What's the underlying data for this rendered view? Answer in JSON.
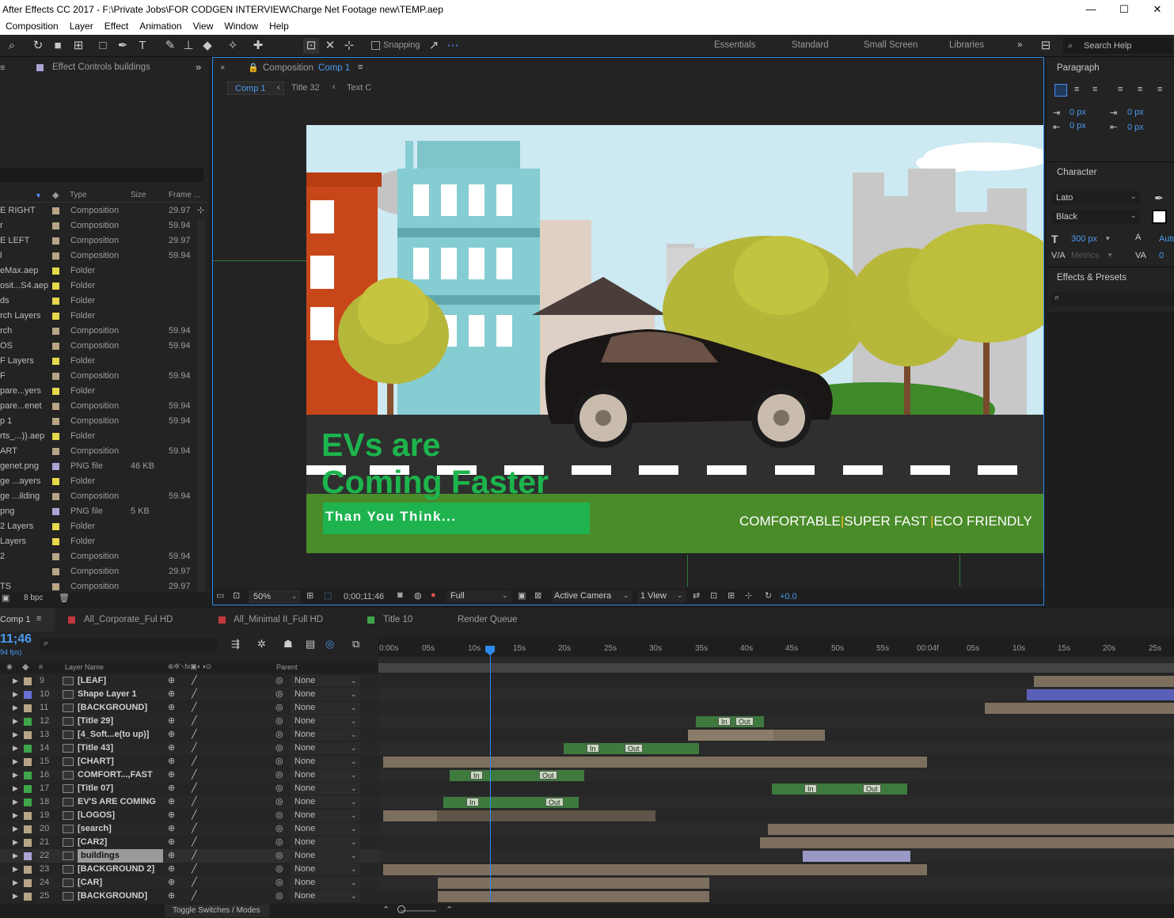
{
  "title": "After Effects CC 2017 - F:\\Private Jobs\\FOR CODGEN INTERVIEW\\Charge Net Footage new\\TEMP.aep",
  "window_controls": [
    "—",
    "☐",
    "✕"
  ],
  "menu": [
    "Composition",
    "Layer",
    "Effect",
    "Animation",
    "View",
    "Window",
    "Help"
  ],
  "toolbar": {
    "snapping": "Snapping",
    "workspaces": [
      "Essentials",
      "Standard",
      "Small Screen",
      "Libraries"
    ],
    "search_placeholder": "Search Help"
  },
  "project": {
    "tab": "Effect Controls buildings",
    "columns": {
      "type": "Type",
      "size": "Size",
      "frame": "Frame ..."
    },
    "rows": [
      {
        "name": "E RIGHT",
        "type": "Composition",
        "size": "",
        "frame": "29.97",
        "color": "#b7a586"
      },
      {
        "name": "r",
        "type": "Composition",
        "size": "",
        "frame": "59.94",
        "color": "#b7a586"
      },
      {
        "name": "E LEFT",
        "type": "Composition",
        "size": "",
        "frame": "29.97",
        "color": "#b7a586"
      },
      {
        "name": "l",
        "type": "Composition",
        "size": "",
        "frame": "59.94",
        "color": "#b7a586"
      },
      {
        "name": "eMax.aep",
        "type": "Folder",
        "size": "",
        "frame": "",
        "color": "#e6d84a"
      },
      {
        "name": "osit...S4.aep",
        "type": "Folder",
        "size": "",
        "frame": "",
        "color": "#e6d84a"
      },
      {
        "name": "ds",
        "type": "Folder",
        "size": "",
        "frame": "",
        "color": "#e6d84a"
      },
      {
        "name": "rch Layers",
        "type": "Folder",
        "size": "",
        "frame": "",
        "color": "#e6d84a"
      },
      {
        "name": "rch",
        "type": "Composition",
        "size": "",
        "frame": "59.94",
        "color": "#b7a586"
      },
      {
        "name": "OS",
        "type": "Composition",
        "size": "",
        "frame": "59.94",
        "color": "#b7a586"
      },
      {
        "name": "F Layers",
        "type": "Folder",
        "size": "",
        "frame": "",
        "color": "#e6d84a"
      },
      {
        "name": "F",
        "type": "Composition",
        "size": "",
        "frame": "59.94",
        "color": "#b7a586"
      },
      {
        "name": "pare...yers",
        "type": "Folder",
        "size": "",
        "frame": "",
        "color": "#e6d84a"
      },
      {
        "name": "pare...enet",
        "type": "Composition",
        "size": "",
        "frame": "59.94",
        "color": "#b7a586"
      },
      {
        "name": "p 1",
        "type": "Composition",
        "size": "",
        "frame": "59.94",
        "color": "#b7a586"
      },
      {
        "name": "rts_...)).aep",
        "type": "Folder",
        "size": "",
        "frame": "",
        "color": "#e6d84a"
      },
      {
        "name": "ART",
        "type": "Composition",
        "size": "",
        "frame": "59.94",
        "color": "#b7a586"
      },
      {
        "name": "genet.png",
        "type": "PNG file",
        "size": "46 KB",
        "frame": "",
        "color": "#a9a5d4"
      },
      {
        "name": "ge ...ayers",
        "type": "Folder",
        "size": "",
        "frame": "",
        "color": "#e6d84a"
      },
      {
        "name": "ge ...ilding",
        "type": "Composition",
        "size": "",
        "frame": "59.94",
        "color": "#b7a586"
      },
      {
        "name": "png",
        "type": "PNG file",
        "size": "5 KB",
        "frame": "",
        "color": "#a9a5d4"
      },
      {
        "name": "2 Layers",
        "type": "Folder",
        "size": "",
        "frame": "",
        "color": "#e6d84a"
      },
      {
        "name": " Layers",
        "type": "Folder",
        "size": "",
        "frame": "",
        "color": "#e6d84a"
      },
      {
        "name": "2",
        "type": "Composition",
        "size": "",
        "frame": "59.94",
        "color": "#b7a586"
      },
      {
        "name": "",
        "type": "Composition",
        "size": "",
        "frame": "29.97",
        "color": "#b7a586"
      },
      {
        "name": "TS",
        "type": "Composition",
        "size": "",
        "frame": "29.97",
        "color": "#b7a586"
      }
    ],
    "bpc": "8 bpc"
  },
  "composition": {
    "tab_label": "Composition",
    "tab_name": "Comp 1",
    "breadcrumbs": [
      "Comp 1",
      "Title 32",
      "Text C"
    ],
    "zoom": "50%",
    "timecode": "0;00;11;46",
    "resolution": "Full",
    "camera": "Active Camera",
    "views": "1 View",
    "exposure": "+0.0",
    "frame": {
      "headline1": "EVs are",
      "headline2": "Coming Faster",
      "subline": "Than You Think...",
      "tag1": "COMFORTABLE",
      "tag2": "SUPER FAST",
      "tag3": "ECO FRIENDLY",
      "sep": "|"
    }
  },
  "paragraph": {
    "title": "Paragraph",
    "indent": [
      "0 px",
      "0 px",
      "0 px",
      "0 px"
    ]
  },
  "character": {
    "title": "Character",
    "font": "Lato",
    "style": "Black",
    "size": "300 px",
    "leading": "Auto",
    "kerning": "Metrics",
    "tracking": "0"
  },
  "effects": {
    "title": "Effects & Presets"
  },
  "timeline": {
    "tabs": [
      "Comp 1",
      "All_Corporate_Ful HD",
      "All_Minimal II_Full HD",
      "Title 10",
      "Render Queue"
    ],
    "tab_colors": [
      "#b7a586",
      "#c4383d",
      "#c4383d",
      "#3fa64a"
    ],
    "timecode": "11;46",
    "fps": "94 fps)",
    "headers": {
      "num": "#",
      "name": "Layer Name",
      "parent": "Parent"
    },
    "ticks": [
      "0:00s",
      "05s",
      "10s",
      "15s",
      "20s",
      "25s",
      "30s",
      "35s",
      "40s",
      "45s",
      "50s",
      "55s",
      "00:04f",
      "05s",
      "10s",
      "15s",
      "20s",
      "25s"
    ],
    "keyframe_in": "In",
    "keyframe_out": "Out",
    "toggle": "Toggle Switches / Modes",
    "layers": [
      {
        "num": "9",
        "name": "[LEAF]",
        "color": "#b7a586",
        "parent": "None"
      },
      {
        "num": "10",
        "name": "Shape Layer 1",
        "color": "#6b6fd6",
        "parent": "None"
      },
      {
        "num": "11",
        "name": "[BACKGROUND]",
        "color": "#b7a586",
        "parent": "None"
      },
      {
        "num": "12",
        "name": "[Title 29]",
        "color": "#3fa64a",
        "parent": "None"
      },
      {
        "num": "13",
        "name": "[4_Soft...e(to up)]",
        "color": "#b7a586",
        "parent": "None"
      },
      {
        "num": "14",
        "name": "[Title 43]",
        "color": "#3fa64a",
        "parent": "None"
      },
      {
        "num": "15",
        "name": "[CHART]",
        "color": "#b7a586",
        "parent": "None"
      },
      {
        "num": "16",
        "name": "COMFORT...,FAST",
        "color": "#3fa64a",
        "parent": "None"
      },
      {
        "num": "17",
        "name": "[Title 07]",
        "color": "#3fa64a",
        "parent": "None"
      },
      {
        "num": "18",
        "name": "EV'S ARE COMING",
        "color": "#3fa64a",
        "parent": "None"
      },
      {
        "num": "19",
        "name": "[LOGOS]",
        "color": "#b7a586",
        "parent": "None"
      },
      {
        "num": "20",
        "name": "[search]",
        "color": "#b7a586",
        "parent": "None"
      },
      {
        "num": "21",
        "name": "[CAR2]",
        "color": "#b7a586",
        "parent": "None"
      },
      {
        "num": "22",
        "name": "buildings",
        "color": "#a9a5d4",
        "parent": "None"
      },
      {
        "num": "23",
        "name": "[BACKGROUND 2]",
        "color": "#b7a586",
        "parent": "None"
      },
      {
        "num": "24",
        "name": "[CAR]",
        "color": "#b7a586",
        "parent": "None"
      },
      {
        "num": "25",
        "name": "[BACKGROUND]",
        "color": "#b7a586",
        "parent": "None"
      }
    ]
  }
}
